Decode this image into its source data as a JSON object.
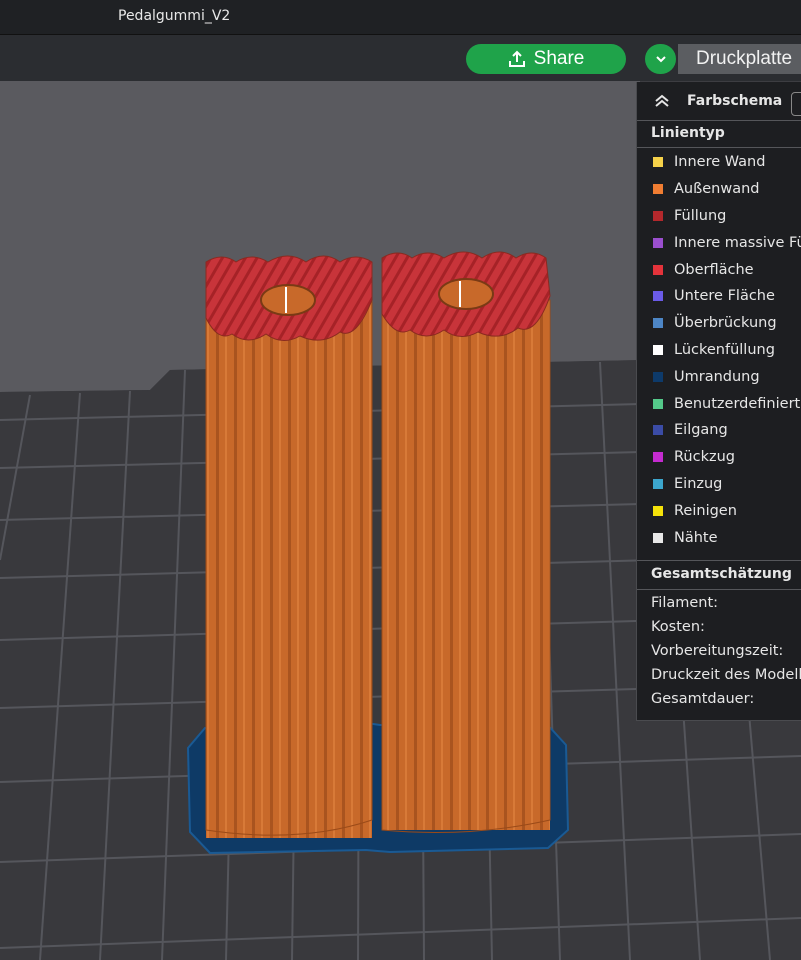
{
  "window": {
    "title": "Pedalgummi_V2"
  },
  "toolbar": {
    "share_label": "Share",
    "plate_label": "Druckplatte"
  },
  "colors": {
    "share_green": "#1fa34a",
    "bed": "#3a3a3e",
    "grid_line": "#55565c",
    "wall_orange": "#c8692a",
    "top_red": "#c8343a",
    "brim_blue": "#0e3a66"
  },
  "panel": {
    "scheme_label": "Farbschema",
    "line_type_header": "Linientyp",
    "legend": [
      {
        "label": "Innere Wand",
        "color": "#f6d24a"
      },
      {
        "label": "Außenwand",
        "color": "#f07d32"
      },
      {
        "label": "Füllung",
        "color": "#b3282c"
      },
      {
        "label": "Innere massive Füllung",
        "color": "#9b4fcf"
      },
      {
        "label": "Oberfläche",
        "color": "#e4333b"
      },
      {
        "label": "Untere Fläche",
        "color": "#6b5be8"
      },
      {
        "label": "Überbrückung",
        "color": "#4d86c6"
      },
      {
        "label": "Lückenfüllung",
        "color": "#ffffff"
      },
      {
        "label": "Umrandung",
        "color": "#0d3a6a"
      },
      {
        "label": "Benutzerdefiniert",
        "color": "#54c98a"
      },
      {
        "label": "Eilgang",
        "color": "#3b4ca6"
      },
      {
        "label": "Rückzug",
        "color": "#c42bd0"
      },
      {
        "label": "Einzug",
        "color": "#3ca6cd"
      },
      {
        "label": "Reinigen",
        "color": "#f5e20a"
      },
      {
        "label": "Nähte",
        "color": "#e8e8e8"
      }
    ],
    "summary_header": "Gesamtschätzung",
    "summary": [
      {
        "label": "Filament:"
      },
      {
        "label": "Kosten:"
      },
      {
        "label": "Vorbereitungszeit:"
      },
      {
        "label": "Druckzeit des Modells:"
      },
      {
        "label": "Gesamtdauer:"
      }
    ]
  }
}
